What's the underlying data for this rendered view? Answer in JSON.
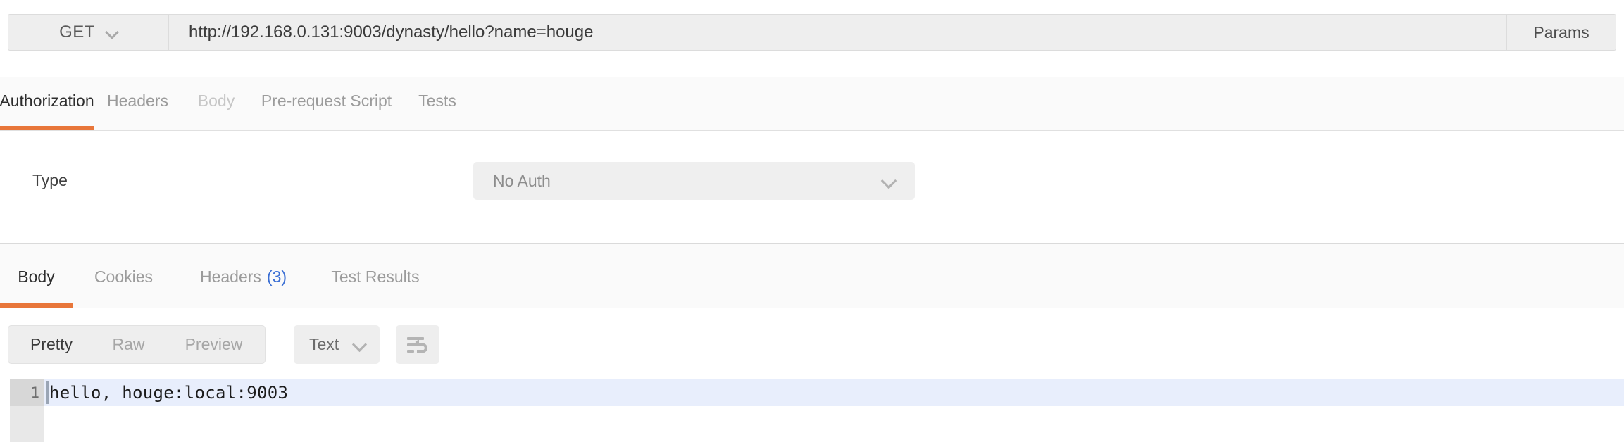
{
  "request": {
    "method": "GET",
    "url": "http://192.168.0.131:9003/dynasty/hello?name=houge",
    "url_placeholder": "Enter request URL",
    "params_label": "Params",
    "tabs": [
      {
        "label": "Authorization",
        "state": "active"
      },
      {
        "label": "Headers",
        "state": "inactive"
      },
      {
        "label": "Body",
        "state": "dim"
      },
      {
        "label": "Pre-request Script",
        "state": "inactive"
      },
      {
        "label": "Tests",
        "state": "inactive"
      }
    ]
  },
  "authorization": {
    "type_label": "Type",
    "type_value": "No Auth"
  },
  "response": {
    "tabs": [
      {
        "label": "Body",
        "state": "active",
        "count": ""
      },
      {
        "label": "Cookies",
        "state": "inactive",
        "count": ""
      },
      {
        "label": "Headers",
        "state": "inactive",
        "count": "(3)"
      },
      {
        "label": "Test Results",
        "state": "inactive",
        "count": ""
      }
    ],
    "view_modes": [
      {
        "label": "Pretty",
        "state": "active"
      },
      {
        "label": "Raw",
        "state": "inactive"
      },
      {
        "label": "Preview",
        "state": "inactive"
      }
    ],
    "format": "Text",
    "wrap_icon": "word-wrap-icon",
    "body": {
      "line_number": "1",
      "text": "hello, houge:local:9003"
    }
  },
  "colors": {
    "accent": "#e8763a",
    "link": "#3b6fd4",
    "panel": "#eeeeee",
    "active_line": "#e8eefc"
  }
}
